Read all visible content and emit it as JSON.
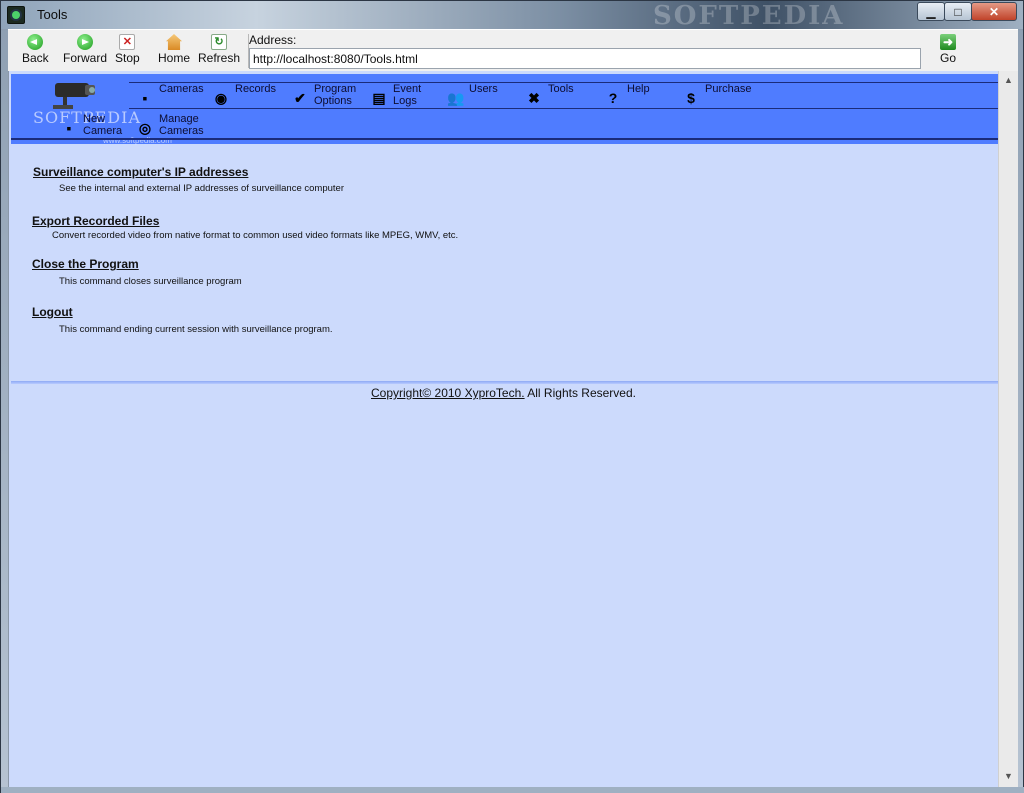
{
  "window": {
    "title": "Tools",
    "watermark": "SOFTPEDIA"
  },
  "window_controls": {
    "minimize": "▁",
    "maximize": "□",
    "close": "✕"
  },
  "toolbar": {
    "back_label": "Back",
    "forward_label": "Forward",
    "stop_label": "Stop",
    "home_label": "Home",
    "refresh_label": "Refresh",
    "address_label": "Address:",
    "address_value": "http://localhost:8080/Tools.html",
    "go_label": "Go"
  },
  "nav": {
    "logo_text": "SOFTPEDIA",
    "logo_sub": "www.softpedia.com",
    "items": [
      {
        "label": "Cameras",
        "icon": "camera-icon"
      },
      {
        "label": "Records",
        "icon": "disc-icon"
      },
      {
        "label": "Program Options",
        "icon": "check-icon"
      },
      {
        "label": "Event Logs",
        "icon": "document-icon"
      },
      {
        "label": "Users",
        "icon": "users-icon"
      },
      {
        "label": "Tools",
        "icon": "tools-icon"
      },
      {
        "label": "Help",
        "icon": "help-icon"
      },
      {
        "label": "Purchase",
        "icon": "dollar-icon"
      }
    ],
    "sub_items": [
      {
        "label": "New Camera",
        "icon": "new-camera-icon"
      },
      {
        "label": "Manage Cameras",
        "icon": "manage-cameras-icon"
      }
    ]
  },
  "content": {
    "items": [
      {
        "title": "Surveillance computer's IP addresses",
        "desc": "See the internal and external IP addresses of surveillance computer"
      },
      {
        "title": "Export Recorded Files",
        "desc": "Convert recorded video from native format to common used video formats like MPEG, WMV, etc."
      },
      {
        "title": "Close the Program",
        "desc": "This command closes surveillance program"
      },
      {
        "title": "Logout",
        "desc": "This command ending current session with surveillance program."
      }
    ]
  },
  "footer": {
    "prefix": "Copyright© 2010 XyproTech.",
    "suffix": " All Rights Reserved."
  },
  "colors": {
    "nav_bg": "#4f7cff",
    "page_bg": "#ccdafc",
    "nav_line": "#1a2b7a"
  }
}
